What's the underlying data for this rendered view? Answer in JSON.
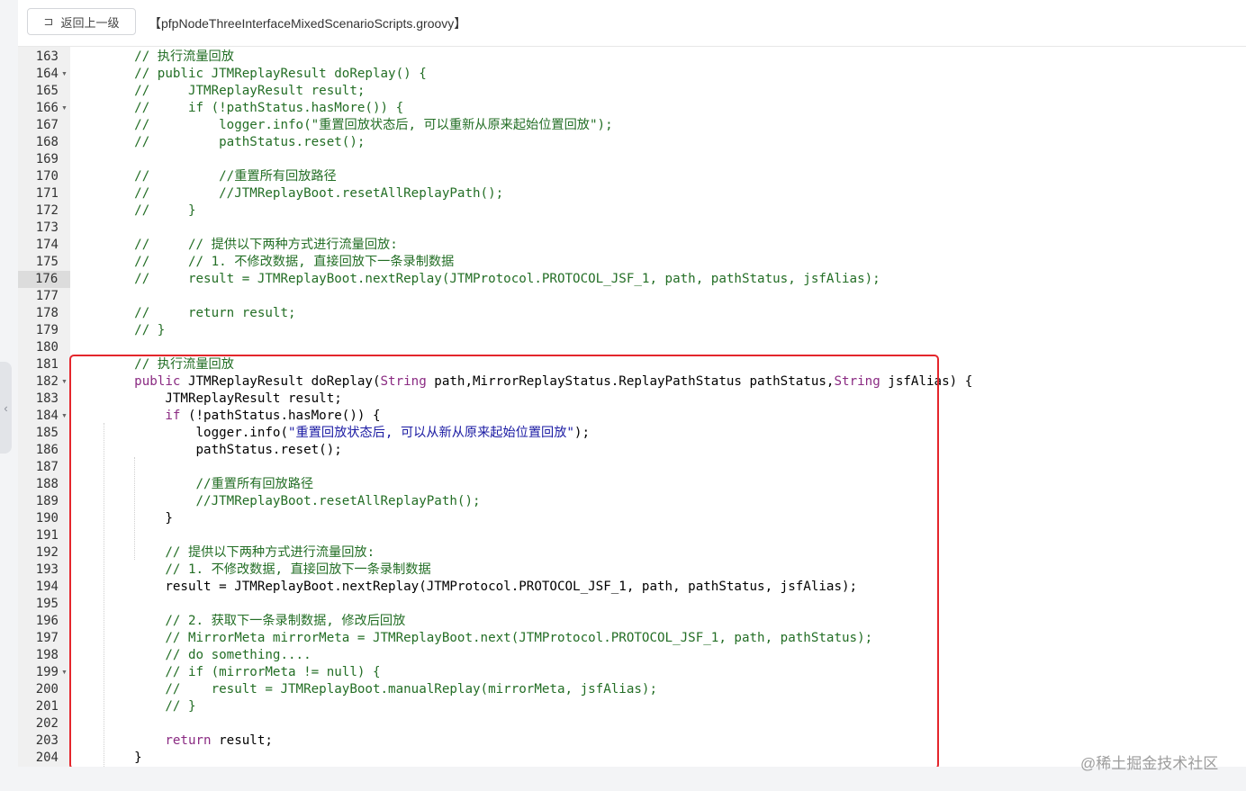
{
  "header": {
    "back_label": "返回上一级",
    "back_icon": "return-arrow-icon",
    "file_title": "【pfpNodeThreeInterfaceMixedScenarioScripts.groovy】"
  },
  "sidebar": {
    "collapse_icon": "chevron-left-icon"
  },
  "editor": {
    "active_line": "176",
    "lines": [
      {
        "n": "163",
        "fold": false,
        "t": [
          {
            "c": "cm",
            "s": "    // 执行流量回放"
          }
        ]
      },
      {
        "n": "164",
        "fold": true,
        "t": [
          {
            "c": "cm",
            "s": "    // public JTMReplayResult doReplay() {"
          }
        ]
      },
      {
        "n": "165",
        "fold": false,
        "t": [
          {
            "c": "cm",
            "s": "    //     JTMReplayResult result;"
          }
        ]
      },
      {
        "n": "166",
        "fold": true,
        "t": [
          {
            "c": "cm",
            "s": "    //     if (!pathStatus.hasMore()) {"
          }
        ]
      },
      {
        "n": "167",
        "fold": false,
        "t": [
          {
            "c": "cm",
            "s": "    //         logger.info(\"重置回放状态后, 可以重新从原来起始位置回放\");"
          }
        ]
      },
      {
        "n": "168",
        "fold": false,
        "t": [
          {
            "c": "cm",
            "s": "    //         pathStatus.reset();"
          }
        ]
      },
      {
        "n": "169",
        "fold": false,
        "t": []
      },
      {
        "n": "170",
        "fold": false,
        "t": [
          {
            "c": "cm",
            "s": "    //         //重置所有回放路径"
          }
        ]
      },
      {
        "n": "171",
        "fold": false,
        "t": [
          {
            "c": "cm",
            "s": "    //         //JTMReplayBoot.resetAllReplayPath();"
          }
        ]
      },
      {
        "n": "172",
        "fold": false,
        "t": [
          {
            "c": "cm",
            "s": "    //     }"
          }
        ]
      },
      {
        "n": "173",
        "fold": false,
        "t": []
      },
      {
        "n": "174",
        "fold": false,
        "t": [
          {
            "c": "cm",
            "s": "    //     // 提供以下两种方式进行流量回放:"
          }
        ]
      },
      {
        "n": "175",
        "fold": false,
        "t": [
          {
            "c": "cm",
            "s": "    //     // 1. 不修改数据, 直接回放下一条录制数据"
          }
        ]
      },
      {
        "n": "176",
        "fold": false,
        "t": [
          {
            "c": "cm",
            "s": "    //     result = JTMReplayBoot.nextReplay(JTMProtocol.PROTOCOL_JSF_1, path, pathStatus, jsfAlias);"
          }
        ]
      },
      {
        "n": "177",
        "fold": false,
        "t": []
      },
      {
        "n": "178",
        "fold": false,
        "t": [
          {
            "c": "cm",
            "s": "    //     return result;"
          }
        ]
      },
      {
        "n": "179",
        "fold": false,
        "t": [
          {
            "c": "cm",
            "s": "    // }"
          }
        ]
      },
      {
        "n": "180",
        "fold": false,
        "t": []
      },
      {
        "n": "181",
        "fold": false,
        "t": [
          {
            "c": "cm",
            "s": "    // 执行流量回放"
          }
        ]
      },
      {
        "n": "182",
        "fold": true,
        "t": [
          {
            "c": "",
            "s": "    "
          },
          {
            "c": "kw",
            "s": "public"
          },
          {
            "c": "",
            "s": " JTMReplayResult doReplay("
          },
          {
            "c": "kw",
            "s": "String"
          },
          {
            "c": "",
            "s": " path,MirrorReplayStatus.ReplayPathStatus pathStatus,"
          },
          {
            "c": "kw",
            "s": "String"
          },
          {
            "c": "",
            "s": " jsfAlias) {"
          }
        ]
      },
      {
        "n": "183",
        "fold": false,
        "t": [
          {
            "c": "",
            "s": "        JTMReplayResult result;"
          }
        ]
      },
      {
        "n": "184",
        "fold": true,
        "t": [
          {
            "c": "",
            "s": "        "
          },
          {
            "c": "kw",
            "s": "if"
          },
          {
            "c": "",
            "s": " (!pathStatus.hasMore()) {"
          }
        ]
      },
      {
        "n": "185",
        "fold": false,
        "t": [
          {
            "c": "",
            "s": "            logger.info("
          },
          {
            "c": "str",
            "s": "\"重置回放状态后, 可以从新从原来起始位置回放\""
          },
          {
            "c": "",
            "s": ");"
          }
        ]
      },
      {
        "n": "186",
        "fold": false,
        "t": [
          {
            "c": "",
            "s": "            pathStatus.reset();"
          }
        ]
      },
      {
        "n": "187",
        "fold": false,
        "t": []
      },
      {
        "n": "188",
        "fold": false,
        "t": [
          {
            "c": "cm",
            "s": "            //重置所有回放路径"
          }
        ]
      },
      {
        "n": "189",
        "fold": false,
        "t": [
          {
            "c": "cm",
            "s": "            //JTMReplayBoot.resetAllReplayPath();"
          }
        ]
      },
      {
        "n": "190",
        "fold": false,
        "t": [
          {
            "c": "",
            "s": "        }"
          }
        ]
      },
      {
        "n": "191",
        "fold": false,
        "t": []
      },
      {
        "n": "192",
        "fold": false,
        "t": [
          {
            "c": "cm",
            "s": "        // 提供以下两种方式进行流量回放:"
          }
        ]
      },
      {
        "n": "193",
        "fold": false,
        "t": [
          {
            "c": "cm",
            "s": "        // 1. 不修改数据, 直接回放下一条录制数据"
          }
        ]
      },
      {
        "n": "194",
        "fold": false,
        "t": [
          {
            "c": "",
            "s": "        result = JTMReplayBoot.nextReplay(JTMProtocol.PROTOCOL_JSF_1, path, pathStatus, jsfAlias);"
          }
        ]
      },
      {
        "n": "195",
        "fold": false,
        "t": []
      },
      {
        "n": "196",
        "fold": false,
        "t": [
          {
            "c": "cm",
            "s": "        // 2. 获取下一条录制数据, 修改后回放"
          }
        ]
      },
      {
        "n": "197",
        "fold": false,
        "t": [
          {
            "c": "cm",
            "s": "        // MirrorMeta mirrorMeta = JTMReplayBoot.next(JTMProtocol.PROTOCOL_JSF_1, path, pathStatus);"
          }
        ]
      },
      {
        "n": "198",
        "fold": false,
        "t": [
          {
            "c": "cm",
            "s": "        // do something...."
          }
        ]
      },
      {
        "n": "199",
        "fold": true,
        "t": [
          {
            "c": "cm",
            "s": "        // if (mirrorMeta != null) {"
          }
        ]
      },
      {
        "n": "200",
        "fold": false,
        "t": [
          {
            "c": "cm",
            "s": "        //    result = JTMReplayBoot.manualReplay(mirrorMeta, jsfAlias);"
          }
        ]
      },
      {
        "n": "201",
        "fold": false,
        "t": [
          {
            "c": "cm",
            "s": "        // }"
          }
        ]
      },
      {
        "n": "202",
        "fold": false,
        "t": []
      },
      {
        "n": "203",
        "fold": false,
        "t": [
          {
            "c": "",
            "s": "        "
          },
          {
            "c": "kw",
            "s": "return"
          },
          {
            "c": "",
            "s": " result;"
          }
        ]
      },
      {
        "n": "204",
        "fold": false,
        "t": [
          {
            "c": "",
            "s": "    }"
          }
        ]
      }
    ]
  },
  "watermark": "@稀土掘金技术社区",
  "colors": {
    "highlight_box": "#e4262c",
    "comment": "#236e25",
    "keyword": "#8a2a82",
    "string": "#1b1ba3"
  }
}
